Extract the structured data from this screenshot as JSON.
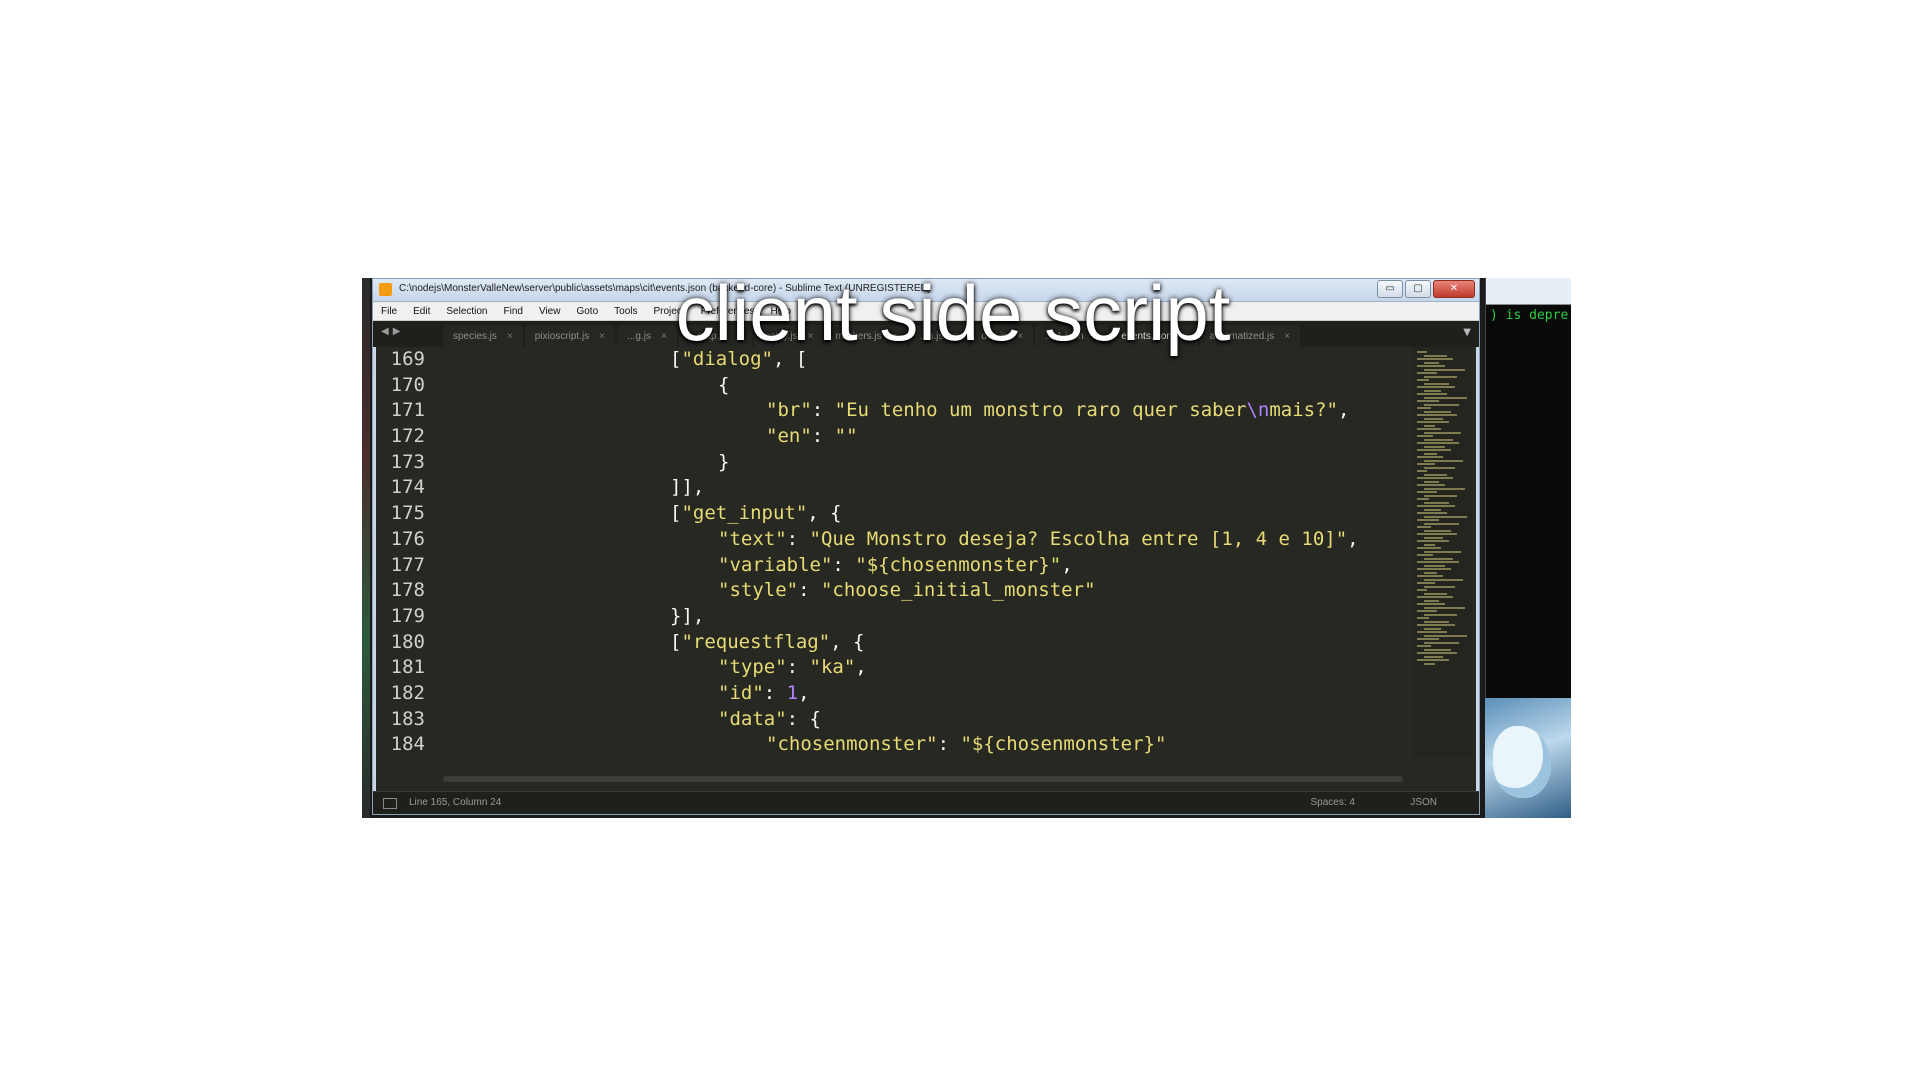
{
  "window": {
    "title": "C:\\nodejs\\MonsterValleNew\\server\\public\\assets\\maps\\cit\\events.json (backend-core) - Sublime Text (UNREGISTERED)",
    "min_label": "▭",
    "max_label": "▢",
    "close_label": "✕"
  },
  "menu": [
    "File",
    "Edit",
    "Selection",
    "Find",
    "View",
    "Goto",
    "Tools",
    "Project",
    "Preferences",
    "Help"
  ],
  "tabs": [
    {
      "label": "species.js",
      "active": false
    },
    {
      "label": "pixioscript.js",
      "active": false
    },
    {
      "label": "...g.js",
      "active": false
    },
    {
      "label": "...map.js",
      "active": false
    },
    {
      "label": "notify.js",
      "active": false
    },
    {
      "label": "markers.js",
      "active": false
    },
    {
      "label": "...n.js",
      "active": false
    },
    {
      "label": "dex.js",
      "active": false
    },
    {
      "label": "...-1.json",
      "active": false
    },
    {
      "label": "events.json",
      "active": true
    },
    {
      "label": "automatized.js",
      "active": false
    }
  ],
  "tab_nav": {
    "prev": "◀",
    "next": "▶"
  },
  "tab_overflow": "▼",
  "code_lines": [
    {
      "n": "169",
      "indent": 0,
      "parts": [
        {
          "t": "[",
          "c": "p"
        },
        {
          "t": "\"dialog\"",
          "c": "s"
        },
        {
          "t": ", [",
          "c": "p"
        }
      ]
    },
    {
      "n": "170",
      "indent": 1,
      "parts": [
        {
          "t": "{",
          "c": "p"
        }
      ]
    },
    {
      "n": "171",
      "indent": 2,
      "parts": [
        {
          "t": "\"br\"",
          "c": "s"
        },
        {
          "t": ": ",
          "c": "p"
        },
        {
          "t": "\"Eu tenho um monstro raro quer saber",
          "c": "s"
        },
        {
          "t": "\\n",
          "c": "e"
        },
        {
          "t": "mais?\"",
          "c": "s"
        },
        {
          "t": ",",
          "c": "p"
        }
      ]
    },
    {
      "n": "172",
      "indent": 2,
      "parts": [
        {
          "t": "\"en\"",
          "c": "s"
        },
        {
          "t": ": ",
          "c": "p"
        },
        {
          "t": "\"\"",
          "c": "s"
        }
      ]
    },
    {
      "n": "173",
      "indent": 1,
      "parts": [
        {
          "t": "}",
          "c": "p"
        }
      ]
    },
    {
      "n": "174",
      "indent": 0,
      "parts": [
        {
          "t": "]],",
          "c": "p"
        }
      ]
    },
    {
      "n": "175",
      "indent": 0,
      "parts": [
        {
          "t": "[",
          "c": "p"
        },
        {
          "t": "\"get_input\"",
          "c": "s"
        },
        {
          "t": ", {",
          "c": "p"
        }
      ]
    },
    {
      "n": "176",
      "indent": 1,
      "parts": [
        {
          "t": "\"text\"",
          "c": "s"
        },
        {
          "t": ": ",
          "c": "p"
        },
        {
          "t": "\"Que Monstro deseja? Escolha entre [1, 4 e 10]\"",
          "c": "s"
        },
        {
          "t": ",",
          "c": "p"
        }
      ]
    },
    {
      "n": "177",
      "indent": 1,
      "parts": [
        {
          "t": "\"variable\"",
          "c": "s"
        },
        {
          "t": ": ",
          "c": "p"
        },
        {
          "t": "\"${chosenmonster}\"",
          "c": "s"
        },
        {
          "t": ",",
          "c": "p"
        }
      ]
    },
    {
      "n": "178",
      "indent": 1,
      "parts": [
        {
          "t": "\"style\"",
          "c": "s"
        },
        {
          "t": ": ",
          "c": "p"
        },
        {
          "t": "\"choose_initial_monster\"",
          "c": "s"
        }
      ]
    },
    {
      "n": "179",
      "indent": 0,
      "parts": [
        {
          "t": "}],",
          "c": "p"
        }
      ]
    },
    {
      "n": "180",
      "indent": 0,
      "parts": [
        {
          "t": "[",
          "c": "p"
        },
        {
          "t": "\"requestflag\"",
          "c": "s"
        },
        {
          "t": ", {",
          "c": "p"
        }
      ]
    },
    {
      "n": "181",
      "indent": 1,
      "parts": [
        {
          "t": "\"type\"",
          "c": "s"
        },
        {
          "t": ": ",
          "c": "p"
        },
        {
          "t": "\"ka\"",
          "c": "s"
        },
        {
          "t": ",",
          "c": "p"
        }
      ]
    },
    {
      "n": "182",
      "indent": 1,
      "parts": [
        {
          "t": "\"id\"",
          "c": "s"
        },
        {
          "t": ": ",
          "c": "p"
        },
        {
          "t": "1",
          "c": "n"
        },
        {
          "t": ",",
          "c": "p"
        }
      ]
    },
    {
      "n": "183",
      "indent": 1,
      "parts": [
        {
          "t": "\"data\"",
          "c": "s"
        },
        {
          "t": ": {",
          "c": "p"
        }
      ]
    },
    {
      "n": "184",
      "indent": 2,
      "parts": [
        {
          "t": "\"chosenmonster\"",
          "c": "s"
        },
        {
          "t": ": ",
          "c": "p"
        },
        {
          "t": "\"${chosenmonster}\"",
          "c": "s"
        }
      ]
    }
  ],
  "status": {
    "position": "Line 165, Column 24",
    "spaces": "Spaces: 4",
    "syntax": "JSON"
  },
  "terminal_text": ") is depre",
  "caption": "client side script"
}
